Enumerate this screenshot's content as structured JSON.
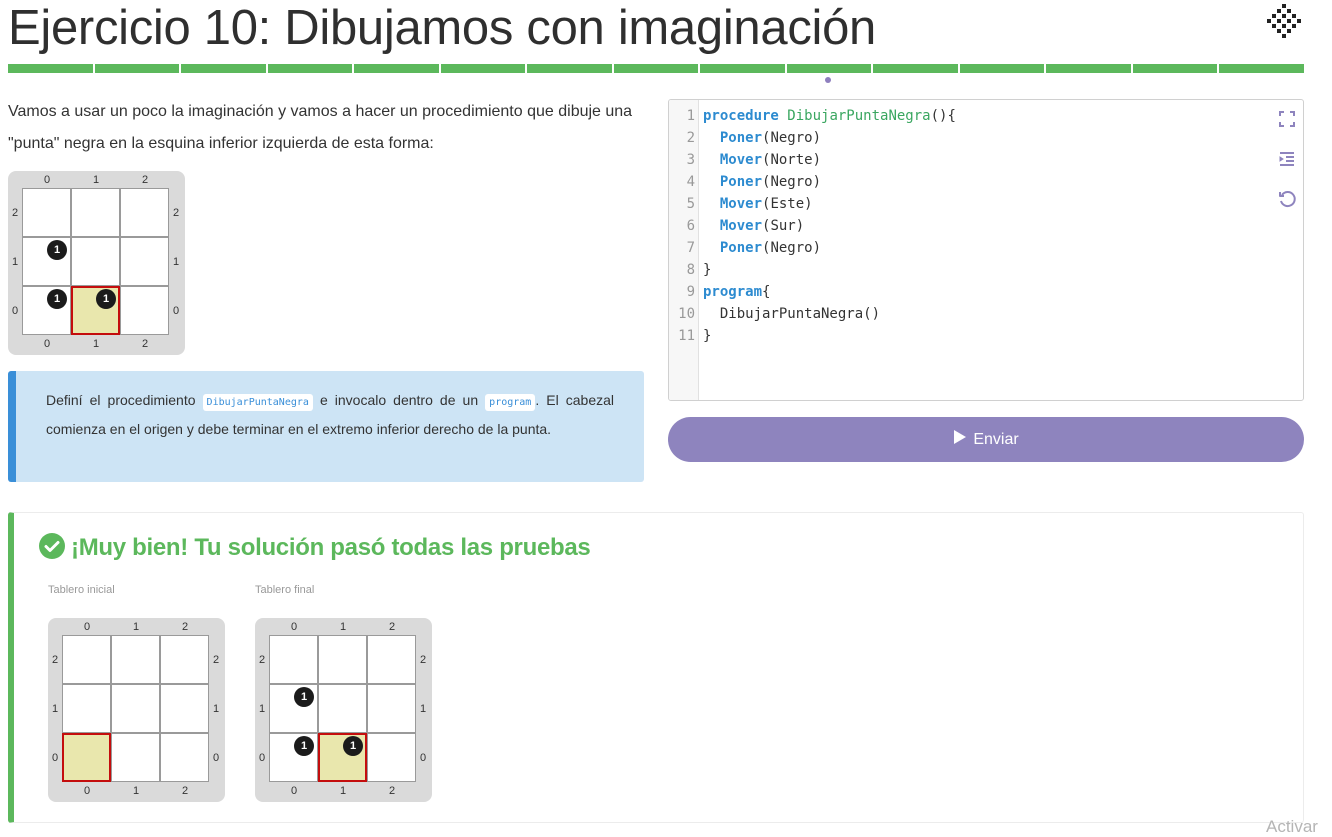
{
  "header": {
    "title": "Ejercicio 10: Dibujamos con imaginación",
    "progress_segments": 15,
    "current_segment": 10
  },
  "intro": {
    "text": "Vamos a usar un poco la imaginación y vamos a hacer un procedimiento que dibuje una \"punta\" negra en la esquina inferior izquierda de esta forma:"
  },
  "example_board": {
    "col_labels": [
      "0",
      "1",
      "2"
    ],
    "row_labels": [
      "2",
      "1",
      "0"
    ],
    "balls": [
      {
        "col": 0,
        "row": 1,
        "count": "1"
      },
      {
        "col": 0,
        "row": 0,
        "count": "1"
      },
      {
        "col": 1,
        "row": 0,
        "count": "1"
      }
    ],
    "head": {
      "col": 1,
      "row": 0
    }
  },
  "hint": {
    "pre": "Definí el procedimiento ",
    "code1": "DibujarPuntaNegra",
    "mid": " e invocalo dentro de un ",
    "code2": "program",
    "post": ". El cabezal comienza en el origen y debe terminar en el extremo inferior derecho de la punta."
  },
  "editor": {
    "lines": [
      {
        "n": "1",
        "parts": [
          {
            "t": "procedure",
            "c": "kw"
          },
          {
            "t": " "
          },
          {
            "t": "DibujarPuntaNegra",
            "c": "fn"
          },
          {
            "t": "(){"
          }
        ]
      },
      {
        "n": "2",
        "parts": [
          {
            "t": "  "
          },
          {
            "t": "Poner",
            "c": "kw"
          },
          {
            "t": "(Negro)"
          }
        ]
      },
      {
        "n": "3",
        "parts": [
          {
            "t": "  "
          },
          {
            "t": "Mover",
            "c": "kw"
          },
          {
            "t": "(Norte)"
          }
        ]
      },
      {
        "n": "4",
        "parts": [
          {
            "t": "  "
          },
          {
            "t": "Poner",
            "c": "kw"
          },
          {
            "t": "(Negro)"
          }
        ]
      },
      {
        "n": "5",
        "parts": [
          {
            "t": "  "
          },
          {
            "t": "Mover",
            "c": "kw"
          },
          {
            "t": "(Este)"
          }
        ]
      },
      {
        "n": "6",
        "parts": [
          {
            "t": "  "
          },
          {
            "t": "Mover",
            "c": "kw"
          },
          {
            "t": "(Sur)"
          }
        ]
      },
      {
        "n": "7",
        "parts": [
          {
            "t": "  "
          },
          {
            "t": "Poner",
            "c": "kw"
          },
          {
            "t": "(Negro)"
          }
        ]
      },
      {
        "n": "8",
        "parts": [
          {
            "t": "}"
          }
        ]
      },
      {
        "n": "9",
        "parts": [
          {
            "t": "program",
            "c": "kw"
          },
          {
            "t": "{"
          }
        ]
      },
      {
        "n": "10",
        "parts": [
          {
            "t": "  DibujarPuntaNegra()"
          }
        ]
      },
      {
        "n": "11",
        "parts": [
          {
            "t": "}"
          }
        ]
      }
    ],
    "icons": [
      "fullscreen-icon",
      "indent-icon",
      "reset-icon"
    ]
  },
  "send_button": {
    "label": "Enviar"
  },
  "result": {
    "title": "¡Muy bien! Tu solución pasó todas las pruebas",
    "initial_caption": "Tablero inicial",
    "final_caption": "Tablero final",
    "initial_board": {
      "col_labels": [
        "0",
        "1",
        "2"
      ],
      "row_labels": [
        "2",
        "1",
        "0"
      ],
      "balls": [],
      "head": {
        "col": 0,
        "row": 0
      }
    },
    "final_board": {
      "col_labels": [
        "0",
        "1",
        "2"
      ],
      "row_labels": [
        "2",
        "1",
        "0"
      ],
      "balls": [
        {
          "col": 0,
          "row": 1,
          "count": "1"
        },
        {
          "col": 0,
          "row": 0,
          "count": "1"
        },
        {
          "col": 1,
          "row": 0,
          "count": "1"
        }
      ],
      "head": {
        "col": 1,
        "row": 0
      }
    }
  },
  "watermark": {
    "text": "Activar"
  },
  "colors": {
    "success": "#5cb85c",
    "accent": "#8e84be",
    "hint_bg": "#cde4f5",
    "hint_border": "#3a8fd8",
    "head_fill": "#e9e7ad",
    "head_border": "#c40d0d"
  }
}
